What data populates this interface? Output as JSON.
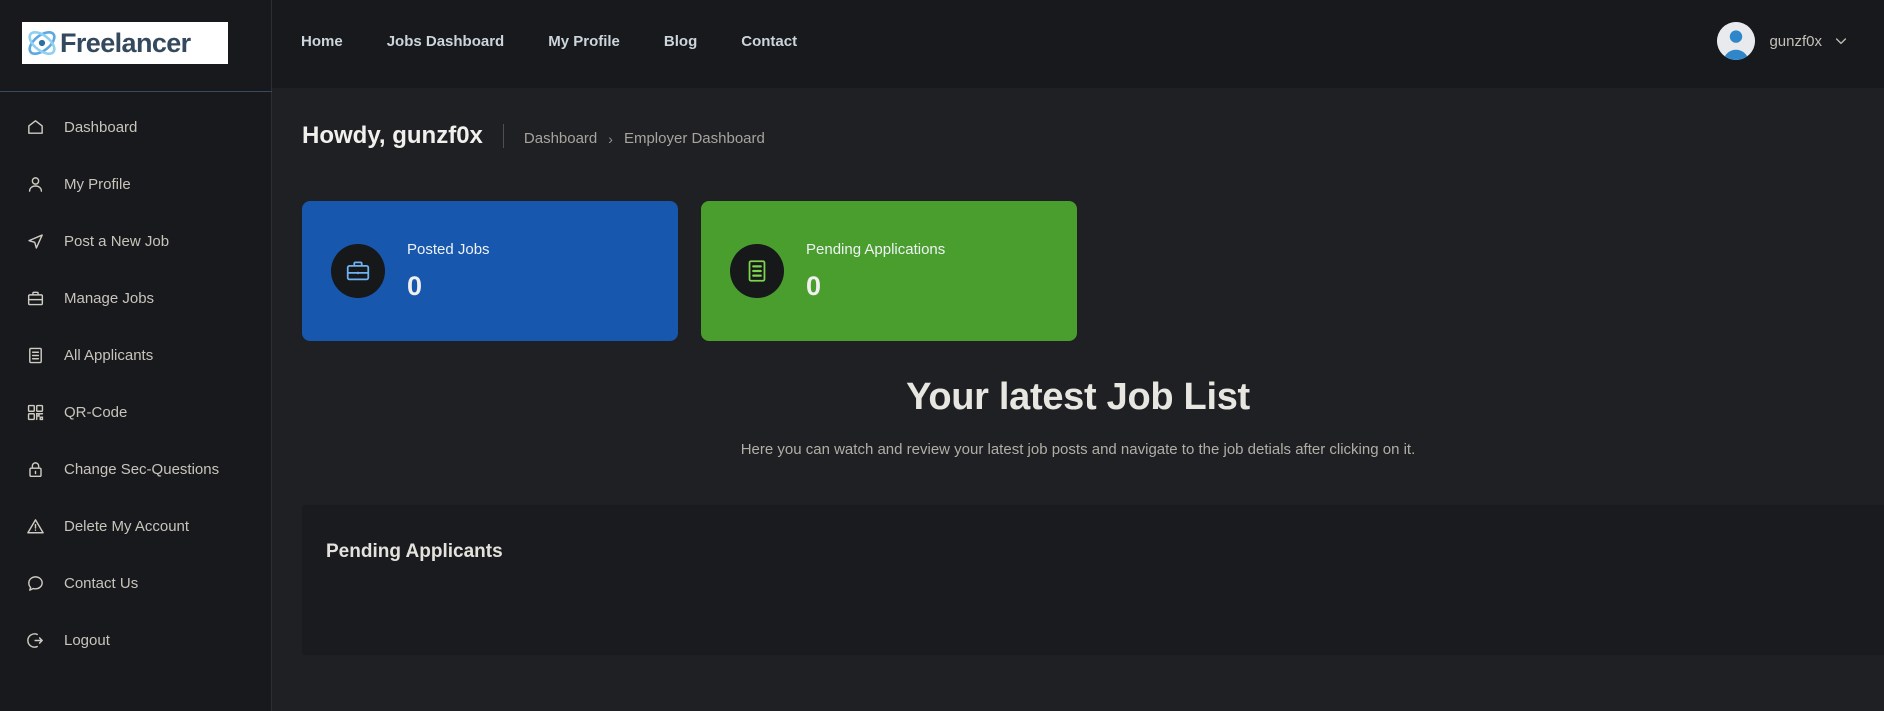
{
  "brand": {
    "logo_text": "Freelancer",
    "logo_icon": "atom-icon",
    "logo_bg": "#ffffff",
    "logo_color": "#34495e"
  },
  "topnav": {
    "items": [
      {
        "label": "Home",
        "name": "nav-home"
      },
      {
        "label": "Jobs Dashboard",
        "name": "nav-jobs-dashboard"
      },
      {
        "label": "My Profile",
        "name": "nav-my-profile"
      },
      {
        "label": "Blog",
        "name": "nav-blog"
      },
      {
        "label": "Contact",
        "name": "nav-contact"
      }
    ],
    "user": {
      "name": "gunzf0x",
      "avatar_icon": "user-avatar-icon",
      "caret_icon": "chevron-down-icon"
    }
  },
  "sidebar": {
    "items": [
      {
        "label": "Dashboard",
        "icon": "home-icon"
      },
      {
        "label": "My Profile",
        "icon": "user-icon"
      },
      {
        "label": "Post a New Job",
        "icon": "send-icon"
      },
      {
        "label": "Manage Jobs",
        "icon": "briefcase-icon"
      },
      {
        "label": "All Applicants",
        "icon": "document-list-icon"
      },
      {
        "label": "QR-Code",
        "icon": "qr-code-icon"
      },
      {
        "label": "Change Sec-Questions",
        "icon": "lock-icon"
      },
      {
        "label": "Delete My Account",
        "icon": "warning-triangle-icon"
      },
      {
        "label": "Contact Us",
        "icon": "chat-bubble-icon"
      },
      {
        "label": "Logout",
        "icon": "logout-icon"
      }
    ]
  },
  "page": {
    "greeting": "Howdy, gunzf0x",
    "breadcrumb": {
      "root": "Dashboard",
      "separator": "›",
      "current": "Employer Dashboard"
    }
  },
  "stats": {
    "cards": [
      {
        "title": "Posted Jobs",
        "value": "0",
        "color": "#1757ad",
        "icon": "briefcase-icon",
        "icon_color": "#6fb3f2"
      },
      {
        "title": "Pending Applications",
        "value": "0",
        "color": "#4a9e2e",
        "icon": "document-list-icon",
        "icon_color": "#7fd44f"
      }
    ]
  },
  "latest": {
    "title": "Your latest Job List",
    "subtitle": "Here you can watch and review your latest job posts and navigate to the job detials after clicking on it."
  },
  "pending": {
    "title": "Pending Applicants"
  },
  "theme": {
    "page_bg": "#1e2024",
    "chrome_bg": "#17191c",
    "panel_bg": "#191b1e",
    "text": "#c8c4bb",
    "accent_blue": "#1757ad",
    "accent_green": "#4a9e2e"
  }
}
